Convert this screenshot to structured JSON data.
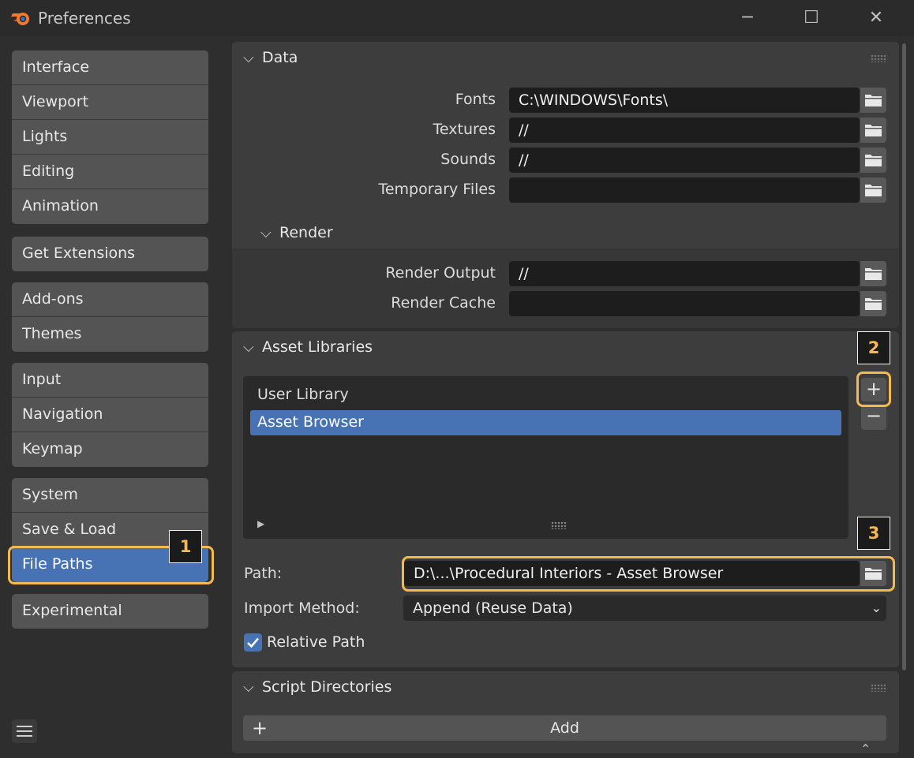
{
  "window": {
    "title": "Preferences",
    "minimize_glyph": "─",
    "maximize_glyph": "☐",
    "close_glyph": "✕",
    "logo_icon": "blender-logo-icon"
  },
  "sidebar": {
    "groups": [
      {
        "items": [
          {
            "label": "Interface"
          },
          {
            "label": "Viewport"
          },
          {
            "label": "Lights"
          },
          {
            "label": "Editing"
          },
          {
            "label": "Animation"
          }
        ]
      },
      {
        "items": [
          {
            "label": "Get Extensions"
          }
        ]
      },
      {
        "items": [
          {
            "label": "Add-ons"
          },
          {
            "label": "Themes"
          }
        ]
      },
      {
        "items": [
          {
            "label": "Input"
          },
          {
            "label": "Navigation"
          },
          {
            "label": "Keymap"
          }
        ]
      },
      {
        "items": [
          {
            "label": "System"
          },
          {
            "label": "Save & Load"
          },
          {
            "label": "File Paths",
            "active": true
          }
        ]
      },
      {
        "items": [
          {
            "label": "Experimental"
          }
        ]
      }
    ],
    "menu_icon": "hamburger-menu-icon"
  },
  "data_panel": {
    "title": "Data",
    "rows": [
      {
        "label": "Fonts",
        "value": "C:\\WINDOWS\\Fonts\\"
      },
      {
        "label": "Textures",
        "value": "//"
      },
      {
        "label": "Sounds",
        "value": "//"
      },
      {
        "label": "Temporary Files",
        "value": ""
      }
    ],
    "render": {
      "title": "Render",
      "rows": [
        {
          "label": "Render Output",
          "value": "//"
        },
        {
          "label": "Render Cache",
          "value": ""
        }
      ]
    }
  },
  "asset_panel": {
    "title": "Asset Libraries",
    "libraries": [
      "User Library",
      "Asset Browser"
    ],
    "selected_index": 1,
    "add_glyph": "+",
    "remove_glyph": "−",
    "path_label": "Path:",
    "path_value": "D:\\...\\Procedural Interiors - Asset Browser",
    "import_label": "Import Method:",
    "import_value": "Append (Reuse Data)",
    "relative_label": "Relative Path",
    "relative_checked": true
  },
  "script_panel": {
    "title": "Script Directories",
    "add_label": "Add",
    "add_glyph": "+"
  },
  "callouts": [
    "1",
    "2",
    "3"
  ],
  "colors": {
    "accent": "#4772b3",
    "highlight": "#f3ba4e",
    "callout_text": "#f7b955"
  }
}
